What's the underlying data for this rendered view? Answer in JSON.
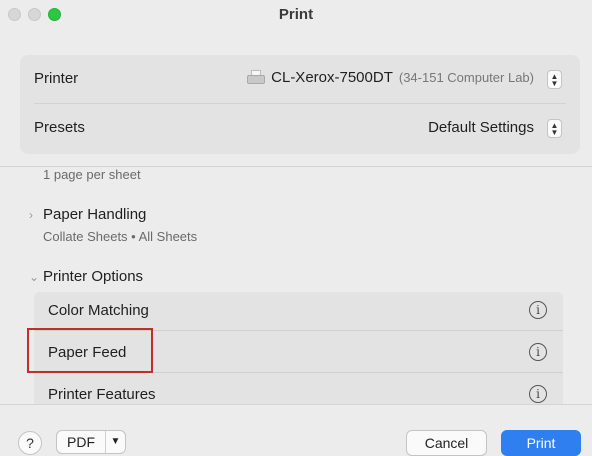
{
  "window": {
    "title": "Print"
  },
  "printer": {
    "label": "Printer",
    "name": "CL-Xerox-7500DT",
    "location": "(34-151 Computer Lab)",
    "icon": "printer-icon"
  },
  "presets": {
    "label": "Presets",
    "value": "Default Settings"
  },
  "layout_summary": "1 page per sheet",
  "paper_handling": {
    "title": "Paper Handling",
    "summary": "Collate Sheets • All Sheets",
    "expanded": false
  },
  "printer_options": {
    "title": "Printer Options",
    "expanded": true,
    "items": [
      {
        "label": "Color Matching",
        "icon": "info-icon"
      },
      {
        "label": "Paper Feed",
        "icon": "info-icon"
      },
      {
        "label": "Printer Features",
        "icon": "info-icon"
      }
    ]
  },
  "footer": {
    "help_label": "?",
    "pdf_label": "PDF",
    "cancel_label": "Cancel",
    "print_label": "Print"
  },
  "colors": {
    "accent": "#2f7ff1",
    "highlight_border": "#c0302a",
    "window_bg": "#ececec"
  }
}
